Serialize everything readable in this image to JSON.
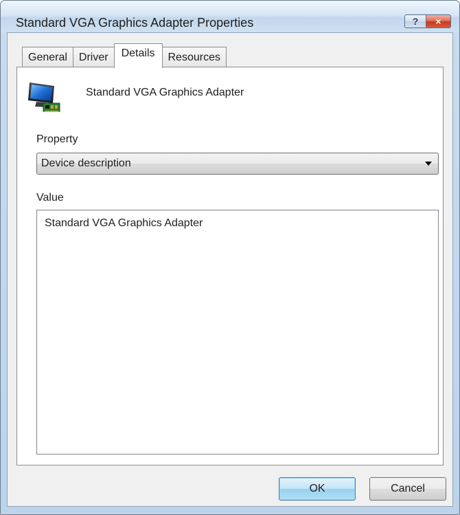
{
  "window": {
    "title": "Standard VGA Graphics Adapter Properties",
    "help_label": "?",
    "close_label": "×"
  },
  "tabs": [
    {
      "label": "General",
      "active": false
    },
    {
      "label": "Driver",
      "active": false
    },
    {
      "label": "Details",
      "active": true
    },
    {
      "label": "Resources",
      "active": false
    }
  ],
  "details": {
    "device_name": "Standard VGA Graphics Adapter",
    "property_label": "Property",
    "property_value": "Device description",
    "value_label": "Value",
    "values": [
      "Standard VGA Graphics Adapter"
    ]
  },
  "buttons": {
    "ok": "OK",
    "cancel": "Cancel"
  },
  "icons": {
    "device": "display-adapter-icon",
    "help": "help-icon",
    "close": "close-icon",
    "dropdown": "chevron-down-icon"
  }
}
